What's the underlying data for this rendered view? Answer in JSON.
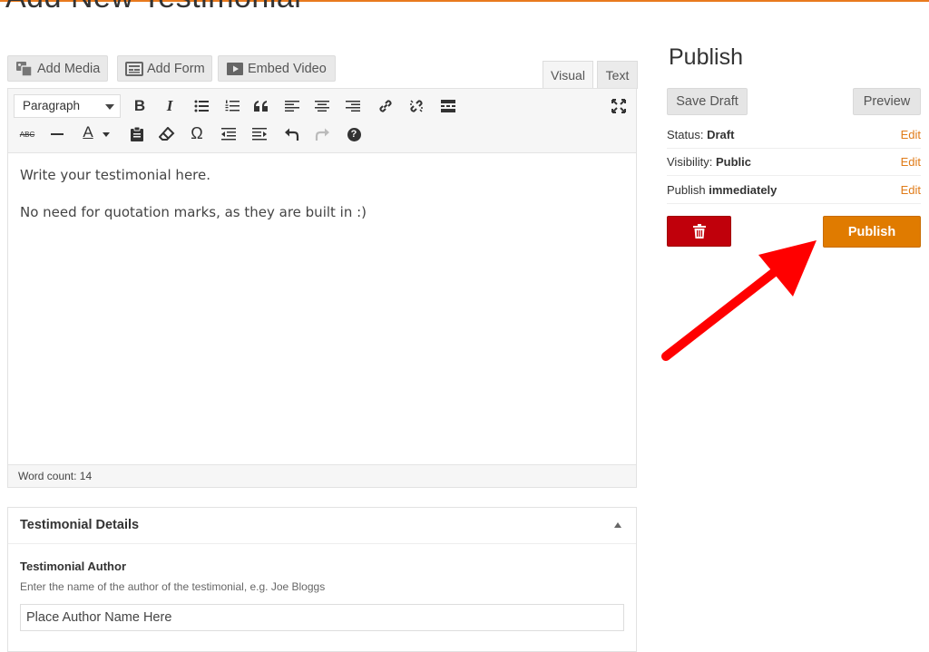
{
  "page": {
    "title": "Add New Testimonial"
  },
  "colors": {
    "accent": "#e07b00",
    "danger": "#c0000b",
    "link": "#e07b18",
    "arrow": "#ff0000"
  },
  "media_buttons": [
    {
      "label": "Add Media",
      "icon": "media-icon"
    },
    {
      "label": "Add Form",
      "icon": "form-icon"
    },
    {
      "label": "Embed Video",
      "icon": "video-icon"
    }
  ],
  "editor": {
    "tabs": {
      "visual": "Visual",
      "text": "Text"
    },
    "format_select": "Paragraph",
    "toolbar_row1": [
      "bold-icon",
      "italic-icon",
      "bullet-list-icon",
      "numbered-list-icon",
      "blockquote-icon",
      "align-left-icon",
      "align-center-icon",
      "align-right-icon",
      "link-icon",
      "unlink-icon",
      "read-more-icon",
      "fullscreen-icon"
    ],
    "toolbar_row2": [
      "strikethrough-icon",
      "horizontal-line-icon",
      "text-color-icon",
      "paste-text-icon",
      "clear-formatting-icon",
      "special-character-icon",
      "outdent-icon",
      "indent-icon",
      "undo-icon",
      "redo-icon",
      "help-icon"
    ],
    "content": {
      "line1": "Write your testimonial here.",
      "line2": "No need for quotation marks, as they are built in :)"
    },
    "word_count": "Word count: 14",
    "bold_glyph": "B",
    "italic_glyph": "I",
    "strike_glyph": "ABC",
    "text_color_glyph": "A",
    "omega_glyph": "Ω",
    "help_glyph": "?"
  },
  "details": {
    "heading": "Testimonial Details",
    "author_label": "Testimonial Author",
    "author_desc": "Enter the name of the author of the testimonial, e.g. Joe Bloggs",
    "author_value": "Place Author Name Here"
  },
  "publish": {
    "title": "Publish",
    "save_draft": "Save Draft",
    "preview": "Preview",
    "status_label": "Status: ",
    "status_value": "Draft",
    "visibility_label": "Visibility: ",
    "visibility_value": "Public",
    "publish_label": "Publish ",
    "publish_value": "immediately",
    "edit_label": "Edit",
    "publish_button": "Publish"
  }
}
